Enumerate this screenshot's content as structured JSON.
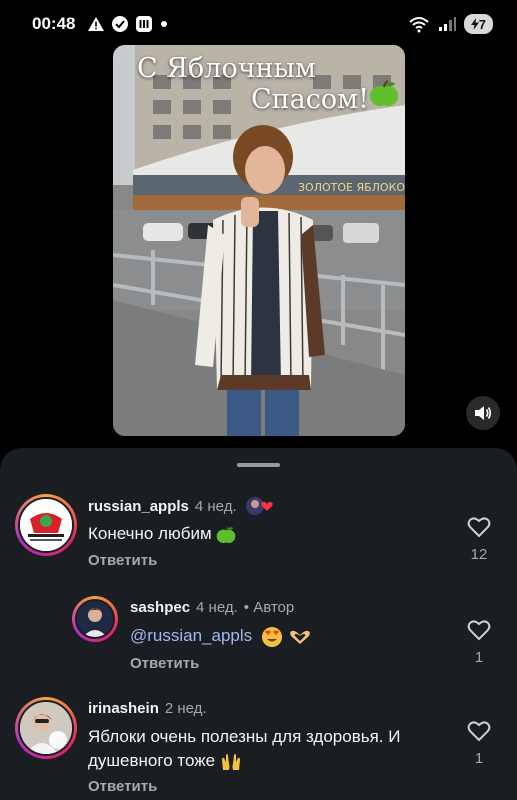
{
  "status_bar": {
    "time": "00:48",
    "battery": "7"
  },
  "video": {
    "caption_line1": "С Яблочным",
    "caption_line2": "Спасом!",
    "store_sign": "ЗОЛОТОЕ ЯБЛОКО"
  },
  "comments": [
    {
      "username": "russian_appls",
      "time": "4 нед.",
      "text": "Конечно любим",
      "reply_label": "Ответить",
      "likes": "12"
    },
    {
      "username": "sashpec",
      "time": "4 нед.",
      "author_tag": "• Автор",
      "mention": "@russian_appls",
      "reply_label": "Ответить",
      "likes": "1"
    },
    {
      "username": "irinashein",
      "time": "2 нед.",
      "text_line1": "Яблоки очень полезны для здоровья. И",
      "text_line2": "душевного тоже",
      "reply_label": "Ответить",
      "likes": "1"
    }
  ]
}
